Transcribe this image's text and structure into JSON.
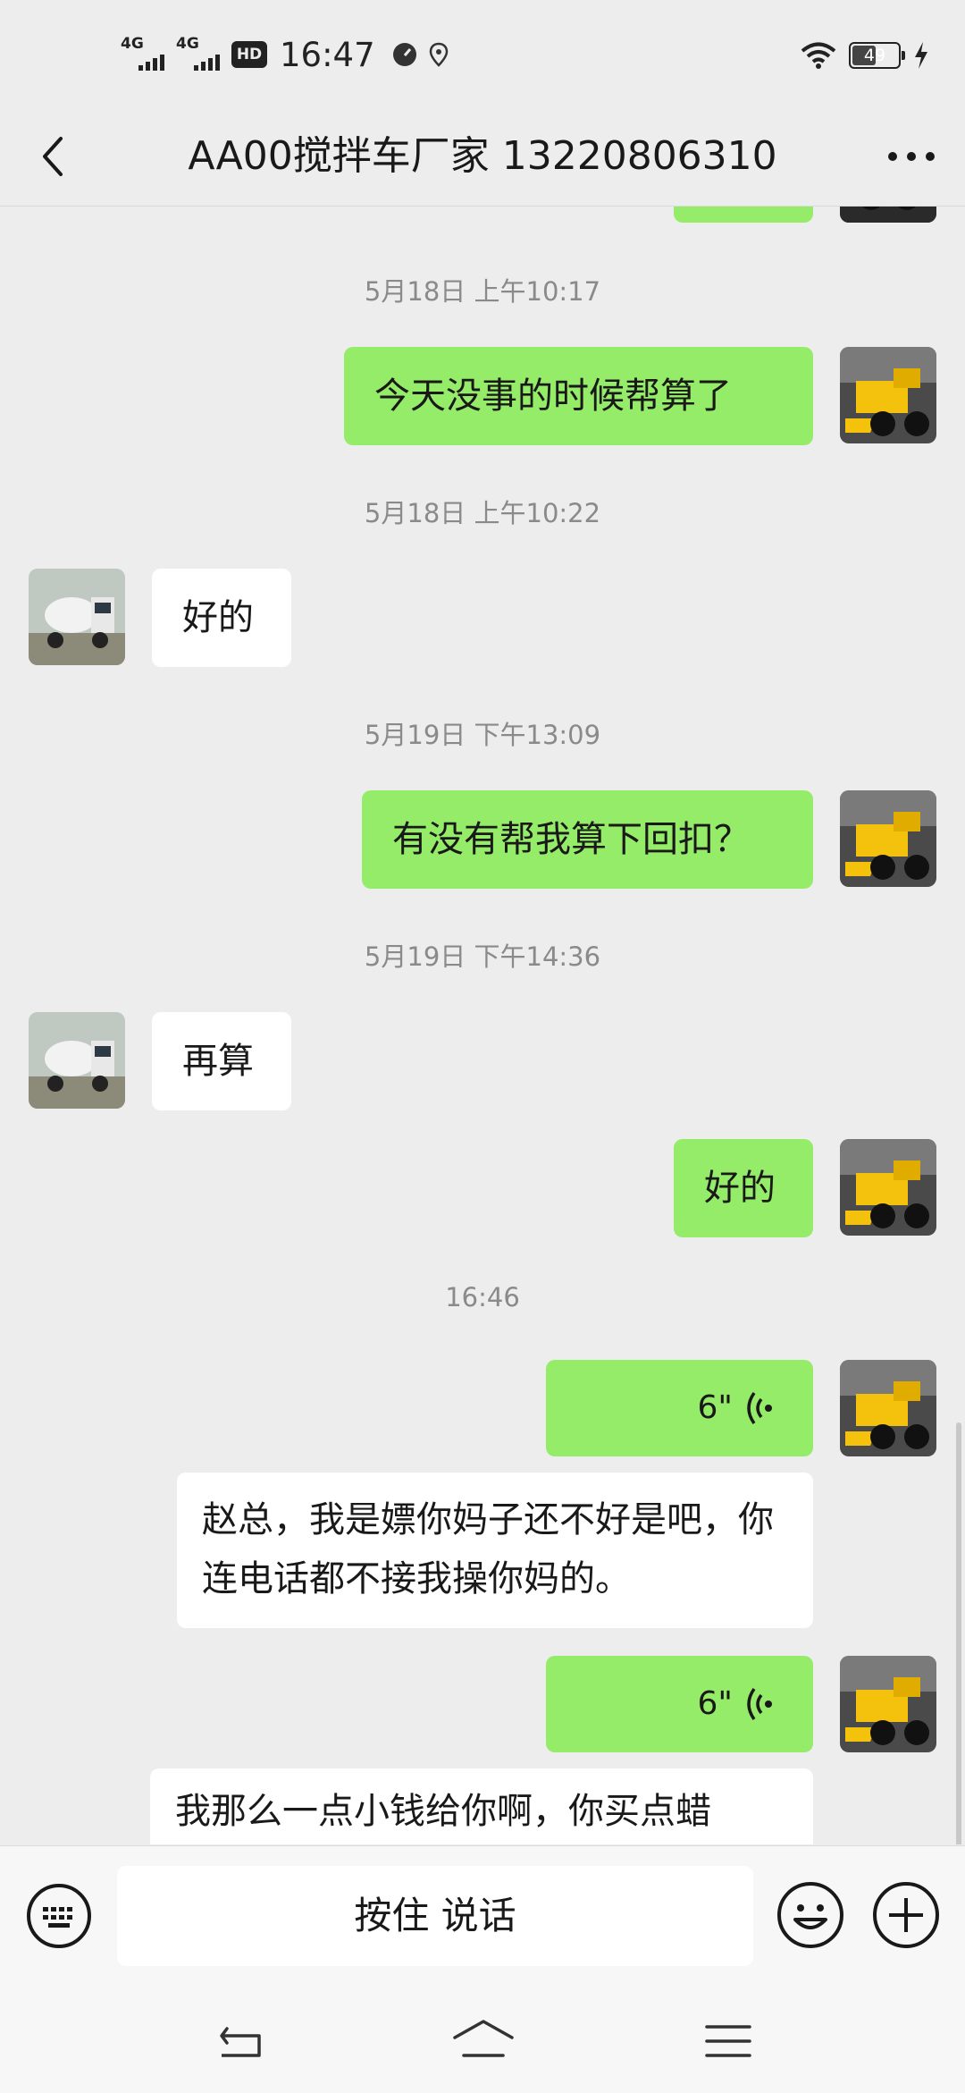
{
  "status_bar": {
    "network1": "4G",
    "network2": "4G",
    "hd": "HD",
    "time": "16:47",
    "battery_level": "49"
  },
  "header": {
    "title": "AA00搅拌车厂家 13220806310",
    "back_icon": "chevron-left-icon",
    "more_icon": "more-dots-icon"
  },
  "messages": [
    {
      "type": "timestamp",
      "text": "5月18日 上午10:17"
    },
    {
      "type": "text",
      "from": "me",
      "text": "今天没事的时候帮算了"
    },
    {
      "type": "timestamp",
      "text": "5月18日 上午10:22"
    },
    {
      "type": "text",
      "from": "other",
      "text": "好的"
    },
    {
      "type": "timestamp",
      "text": "5月19日 下午13:09"
    },
    {
      "type": "text",
      "from": "me",
      "text": "有没有帮我算下回扣？"
    },
    {
      "type": "timestamp",
      "text": "5月19日 下午14:36"
    },
    {
      "type": "text",
      "from": "other",
      "text": "再算"
    },
    {
      "type": "text",
      "from": "me",
      "text": "好的"
    },
    {
      "type": "timestamp",
      "text": "16:46"
    },
    {
      "type": "voice",
      "from": "me",
      "duration": "6\""
    },
    {
      "type": "transcript",
      "text": "赵总，我是嫖你妈子还不好是吧，你连电话都不接我操你妈的。"
    },
    {
      "type": "voice",
      "from": "me",
      "duration": "6\""
    },
    {
      "type": "transcript",
      "text": "我那么一点小钱给你啊，你买点蜡"
    }
  ],
  "input_bar": {
    "talk_label": "按住 说话",
    "keyboard_icon": "keyboard-icon",
    "emoji_icon": "emoji-icon",
    "plus_icon": "plus-icon"
  },
  "nav": {
    "back_icon": "nav-back-icon",
    "home_icon": "nav-home-icon",
    "menu_icon": "nav-menu-icon"
  },
  "colors": {
    "background": "#ededed",
    "my_bubble": "#95ec69",
    "their_bubble": "#ffffff",
    "timestamp": "#8a8a8a"
  }
}
